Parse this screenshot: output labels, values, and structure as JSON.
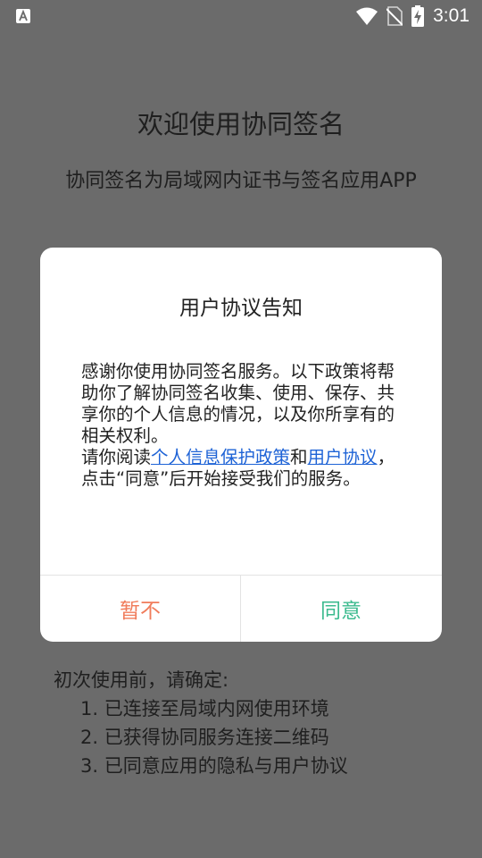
{
  "status_bar": {
    "time": "3:01",
    "icons": [
      "app-notification-icon",
      "wifi-icon",
      "no-sim-icon",
      "battery-charging-icon"
    ]
  },
  "page": {
    "title": "欢迎使用协同签名",
    "subtitle": "协同签名为局域网内证书与签名应用APP",
    "notes_heading": "初次使用前，请确定:",
    "notes": [
      "1. 已连接至局域内网使用环境",
      "2. 已获得协同服务连接二维码",
      "3. 已同意应用的隐私与用户协议"
    ]
  },
  "dialog": {
    "title": "用户协议告知",
    "paragraph1": "感谢你使用协同签名服务。以下政策将帮助你了解协同签名收集、使用、保存、共享你的个人信息的情况，以及你所享有的相关权利。",
    "paragraph2_prefix": "请你阅读",
    "privacy_link": "个人信息保护政策",
    "conjunction": "和",
    "terms_link": "用户协议",
    "paragraph2_suffix": "，点击“同意”后开始接受我们的服务。",
    "decline_label": "暂不",
    "agree_label": "同意"
  },
  "colors": {
    "scrim_background": "#6b6b6b",
    "link": "#1e63d6",
    "decline": "#f07c5b",
    "agree": "#3dbb8f"
  }
}
